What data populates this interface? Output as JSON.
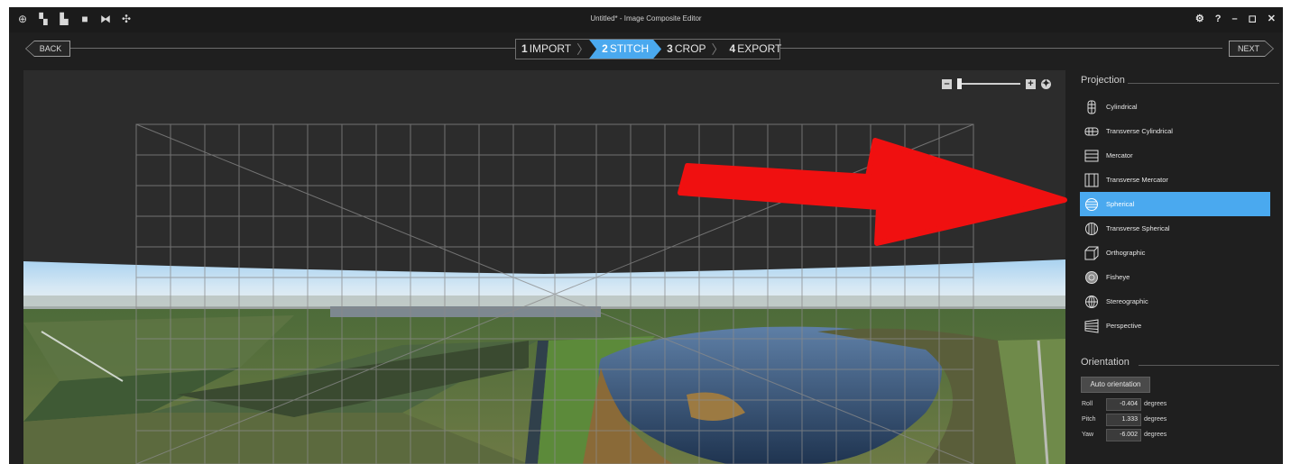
{
  "window": {
    "title": "Untitled* - Image Composite Editor",
    "toolbar_icons": [
      "new-panorama-icon",
      "new-panorama-from-video-icon",
      "new-panorama-from-files-icon",
      "open-icon",
      "save-icon",
      "publish-icon"
    ],
    "controls": {
      "settings": "⚙",
      "help": "?",
      "minimize": "–",
      "maximize": "◻",
      "close": "✕"
    }
  },
  "wizard": {
    "back_label": "BACK",
    "next_label": "NEXT",
    "steps": [
      {
        "num": "1",
        "label": "IMPORT"
      },
      {
        "num": "2",
        "label": "STITCH"
      },
      {
        "num": "3",
        "label": "CROP"
      },
      {
        "num": "4",
        "label": "EXPORT"
      }
    ],
    "active_step": "STITCH"
  },
  "zoom": {
    "minus": "–",
    "plus": "+"
  },
  "panel": {
    "projection_title": "Projection",
    "projections": [
      {
        "label": "Cylindrical",
        "icon": "cylindrical-icon"
      },
      {
        "label": "Transverse Cylindrical",
        "icon": "transverse-cylindrical-icon"
      },
      {
        "label": "Mercator",
        "icon": "mercator-icon"
      },
      {
        "label": "Transverse Mercator",
        "icon": "transverse-mercator-icon"
      },
      {
        "label": "Spherical",
        "icon": "spherical-icon"
      },
      {
        "label": "Transverse Spherical",
        "icon": "transverse-spherical-icon"
      },
      {
        "label": "Orthographic",
        "icon": "orthographic-icon"
      },
      {
        "label": "Fisheye",
        "icon": "fisheye-icon"
      },
      {
        "label": "Stereographic",
        "icon": "stereographic-icon"
      },
      {
        "label": "Perspective",
        "icon": "perspective-icon"
      }
    ],
    "selected_projection": "Spherical",
    "orientation_title": "Orientation",
    "auto_orientation_label": "Auto orientation",
    "orientation": [
      {
        "label": "Roll",
        "value": "-0.404",
        "unit": "degrees"
      },
      {
        "label": "Pitch",
        "value": "1.333",
        "unit": "degrees"
      },
      {
        "label": "Yaw",
        "value": "-6.002",
        "unit": "degrees"
      }
    ]
  },
  "colors": {
    "accent": "#4aa9ef",
    "annotation_arrow": "#f01010",
    "background": "#1f1f1f"
  }
}
